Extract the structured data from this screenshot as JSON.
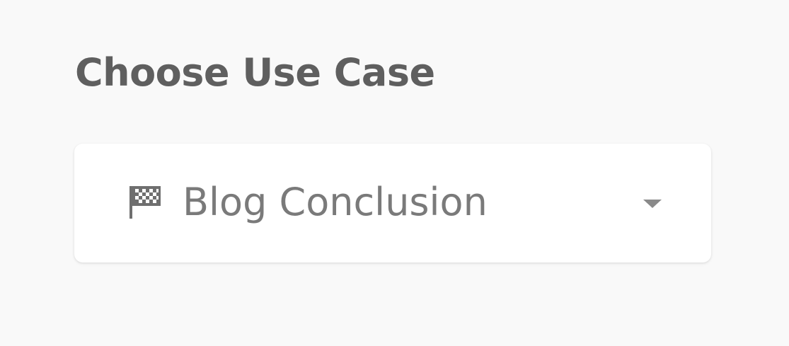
{
  "section": {
    "title": "Choose Use Case"
  },
  "use_case_select": {
    "selected_label": "Blog Conclusion",
    "selected_icon": "checkered-flag-icon",
    "dropdown_icon": "caret-down-icon"
  },
  "colors": {
    "background": "#f9f9f9",
    "title_text": "#5f5f5f",
    "value_text": "#7a7a7a",
    "icon": "#6f6f6f",
    "card": "#ffffff"
  }
}
